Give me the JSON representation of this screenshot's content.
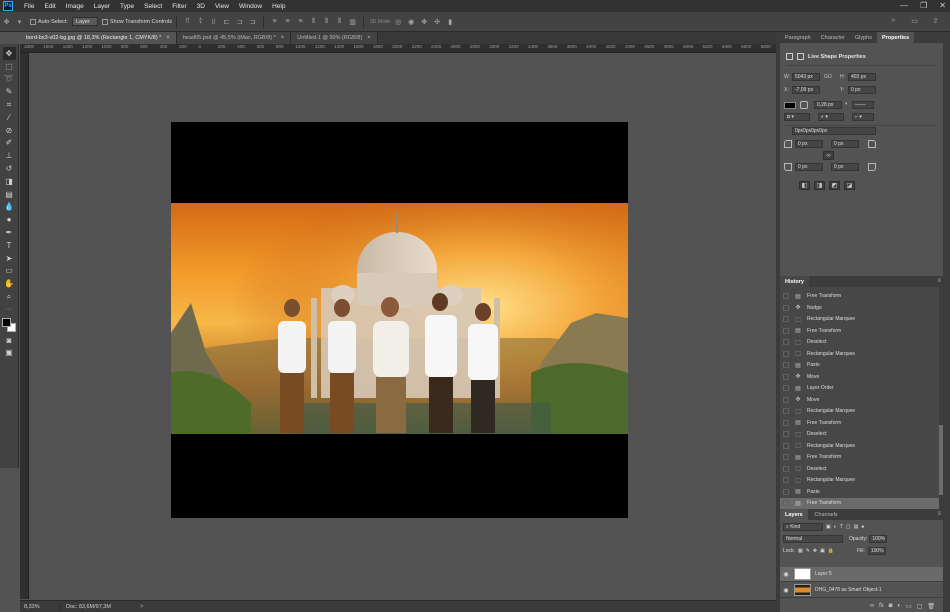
{
  "menubar": {
    "logo": "Ps",
    "items": [
      "File",
      "Edit",
      "Image",
      "Layer",
      "Type",
      "Select",
      "Filter",
      "3D",
      "View",
      "Window",
      "Help"
    ],
    "window_controls": [
      "—",
      "❐",
      "✕"
    ]
  },
  "options": {
    "auto_select_label": "Auto-Select:",
    "auto_select_value": "Layer",
    "show_transform_label": "Show Transform Controls",
    "three_d_mode_label": "3D Mode:"
  },
  "tabs": [
    {
      "label": "bord-bx3-v02-bg.jpg @ 18,3% (Rectangle 1, CMYK/8) *",
      "active": true
    },
    {
      "label": "head05.psd @ 45,5% (iMac, RGB/8) *",
      "active": false
    },
    {
      "label": "Untitled-1 @ 50% (RGB/8)",
      "active": false
    }
  ],
  "ruler": {
    "labels": [
      "1800",
      "1600",
      "1400",
      "1200",
      "1000",
      "800",
      "600",
      "400",
      "200",
      "0",
      "200",
      "400",
      "600",
      "800",
      "1000",
      "1200",
      "1400",
      "1600",
      "1800",
      "2000",
      "2200",
      "2400",
      "2600",
      "2800",
      "3000",
      "3200",
      "3400",
      "3600",
      "3800",
      "4000",
      "4200",
      "4400",
      "4600",
      "4800",
      "5000",
      "5200",
      "5400",
      "5600",
      "5800"
    ]
  },
  "status": {
    "zoom": "8,33%",
    "doc": "Doc: 83,6M/97,3M",
    "arrow": ">"
  },
  "properties": {
    "tabs": [
      "Paragraph",
      "Character",
      "Glyphs",
      "Properties"
    ],
    "active_tab": "Properties",
    "title": "Live Shape Properties",
    "w_label": "W:",
    "w_value": "5043 px",
    "link_label": "GO",
    "h_label": "H:",
    "h_value": "403 px",
    "x_label": "X:",
    "x_value": "-7,09 px",
    "y_label": "Y:",
    "y_value": "0 px",
    "stroke_width": "0,28 px",
    "corner_label": "0px0px0px0px",
    "corner_tl": "0 px",
    "corner_tr": "0 px",
    "corner_bl": "0 px",
    "corner_br": "0 px",
    "link_icon": "∞",
    "fill_color": "#000000"
  },
  "history": {
    "tab": "History",
    "items": [
      {
        "label": "Free Transform",
        "icon": "doc"
      },
      {
        "label": "Nudge",
        "icon": "move"
      },
      {
        "label": "Rectangular Marquee",
        "icon": "marquee"
      },
      {
        "label": "Free Transform",
        "icon": "doc"
      },
      {
        "label": "Deselect",
        "icon": "marquee"
      },
      {
        "label": "Rectangular Marquee",
        "icon": "marquee"
      },
      {
        "label": "Paste",
        "icon": "doc"
      },
      {
        "label": "Move",
        "icon": "move"
      },
      {
        "label": "Layer Order",
        "icon": "doc"
      },
      {
        "label": "Move",
        "icon": "move"
      },
      {
        "label": "Rectangular Marquee",
        "icon": "marquee"
      },
      {
        "label": "Free Transform",
        "icon": "doc"
      },
      {
        "label": "Deselect",
        "icon": "marquee"
      },
      {
        "label": "Rectangular Marquee",
        "icon": "marquee"
      },
      {
        "label": "Free Transform",
        "icon": "doc"
      },
      {
        "label": "Deselect",
        "icon": "marquee"
      },
      {
        "label": "Rectangular Marquee",
        "icon": "marquee"
      },
      {
        "label": "Paste",
        "icon": "doc"
      },
      {
        "label": "Free Transform",
        "icon": "doc"
      }
    ]
  },
  "layers": {
    "tabs": [
      "Layers",
      "Channels"
    ],
    "kind_label": "Kind",
    "blend_mode": "Normal",
    "opacity_label": "Opacity:",
    "opacity_value": "100%",
    "lock_label": "Lock:",
    "fill_label": "Fill:",
    "fill_value": "100%",
    "items": [
      {
        "name": "Layer 5",
        "selected": true
      },
      {
        "name": "DHG_0478 as Smart Object-1",
        "selected": false
      }
    ]
  }
}
